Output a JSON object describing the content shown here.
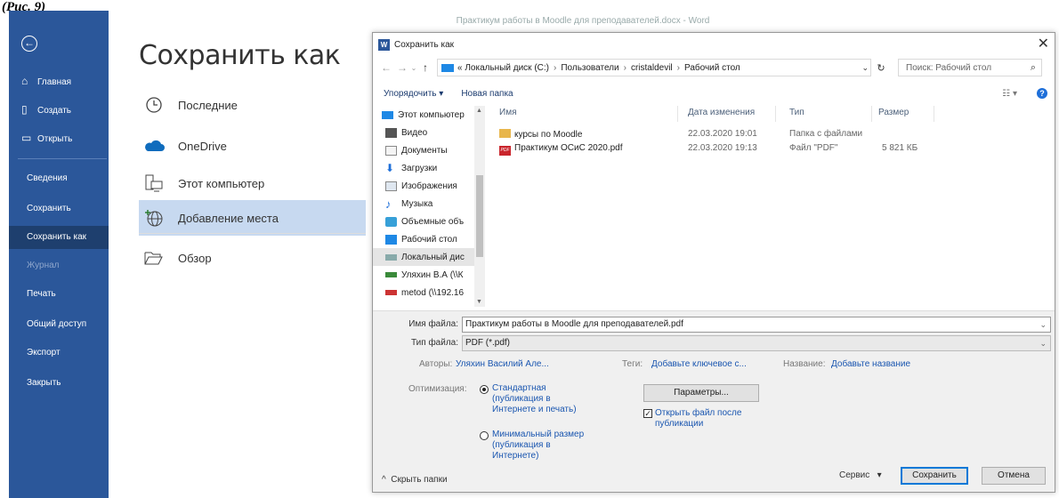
{
  "figure_label": "(Рис. 9)",
  "window_title": "Практикум работы в Moodle для преподавателей.docx  -  Word",
  "sidebar": {
    "items": [
      {
        "label": "Главная",
        "icon": "home-icon"
      },
      {
        "label": "Создать",
        "icon": "new-doc-icon"
      },
      {
        "label": "Открыть",
        "icon": "open-folder-icon"
      },
      {
        "label": "Сведения"
      },
      {
        "label": "Сохранить"
      },
      {
        "label": "Сохранить как"
      },
      {
        "label": "Журнал"
      },
      {
        "label": "Печать"
      },
      {
        "label": "Общий доступ"
      },
      {
        "label": "Экспорт"
      },
      {
        "label": "Закрыть"
      }
    ]
  },
  "page_title": "Сохранить как",
  "locations": [
    {
      "label": "Последние",
      "icon": "clock-icon"
    },
    {
      "label": "OneDrive",
      "icon": "cloud-icon"
    },
    {
      "label": "Этот компьютер",
      "icon": "computer-icon"
    },
    {
      "label": "Добавление места",
      "icon": "add-place-icon"
    },
    {
      "label": "Обзор",
      "icon": "browse-folder-icon"
    }
  ],
  "dialog": {
    "title": "Сохранить как",
    "address": {
      "prefix": "«",
      "crumbs": [
        "Локальный диск (C:)",
        "Пользователи",
        "cristaldevil",
        "Рабочий стол"
      ]
    },
    "search_placeholder": "Поиск: Рабочий стол",
    "toolbar": {
      "organize": "Упорядочить ▾",
      "new_folder": "Новая папка"
    },
    "tree": [
      {
        "label": "Этот компьютер"
      },
      {
        "label": "Видео"
      },
      {
        "label": "Документы"
      },
      {
        "label": "Загрузки"
      },
      {
        "label": "Изображения"
      },
      {
        "label": "Музыка"
      },
      {
        "label": "Объемные объ"
      },
      {
        "label": "Рабочий стол"
      },
      {
        "label": "Локальный дис"
      },
      {
        "label": "Уляхин В.А (\\\\К"
      },
      {
        "label": "metod (\\\\192.16"
      }
    ],
    "columns": {
      "name": "Имя",
      "date": "Дата изменения",
      "type": "Тип",
      "size": "Размер"
    },
    "files": [
      {
        "name": "курсы по Moodle",
        "date": "22.03.2020 19:01",
        "type": "Папка с файлами",
        "size": ""
      },
      {
        "name": "Практикум ОСиС 2020.pdf",
        "date": "22.03.2020 19:13",
        "type": "Файл \"PDF\"",
        "size": "5 821 КБ"
      }
    ],
    "filename_label": "Имя файла:",
    "filename": "Практикум работы в Moodle для преподавателей.pdf",
    "filetype_label": "Тип файла:",
    "filetype": "PDF (*.pdf)",
    "authors_label": "Авторы:",
    "authors": "Уляхин Василий Але...",
    "tags_label": "Теги:",
    "tags": "Добавьте ключевое с...",
    "title_label": "Название:",
    "title_value": "Добавьте название",
    "optimize_label": "Оптимизация:",
    "opt_standard": "Стандартная (публикация в Интернете и печать)",
    "opt_minimal": "Минимальный размер (публикация в Интернете)",
    "params_button": "Параметры...",
    "open_after": "Открыть файл после публикации",
    "hide_folders": "Скрыть папки",
    "service": "Сервис",
    "save_button": "Сохранить",
    "cancel_button": "Отмена"
  }
}
